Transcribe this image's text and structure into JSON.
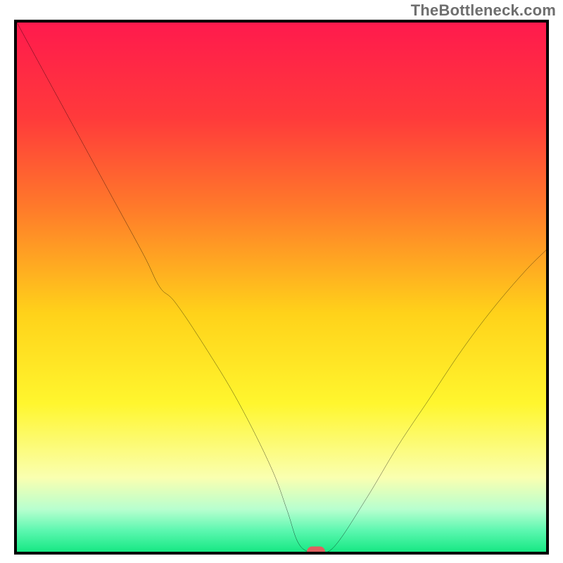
{
  "watermark": "TheBottleneck.com",
  "chart_data": {
    "type": "line",
    "title": "",
    "xlabel": "",
    "ylabel": "",
    "xlim": [
      0,
      100
    ],
    "ylim": [
      0,
      100
    ],
    "grid": false,
    "legend": false,
    "gradient_stops": [
      {
        "pos": 0.0,
        "color": "#ff1a4d"
      },
      {
        "pos": 0.18,
        "color": "#ff3a3b"
      },
      {
        "pos": 0.35,
        "color": "#ff7a2a"
      },
      {
        "pos": 0.55,
        "color": "#ffd21a"
      },
      {
        "pos": 0.72,
        "color": "#fff62e"
      },
      {
        "pos": 0.86,
        "color": "#faffb0"
      },
      {
        "pos": 0.92,
        "color": "#b7ffcf"
      },
      {
        "pos": 0.96,
        "color": "#5cf7b0"
      },
      {
        "pos": 1.0,
        "color": "#17e884"
      }
    ],
    "series": [
      {
        "name": "bottleneck-curve",
        "x": [
          0,
          6,
          12,
          18,
          24,
          27,
          30,
          36,
          42,
          48,
          51,
          53,
          55,
          57,
          60,
          66,
          72,
          78,
          84,
          90,
          96,
          100
        ],
        "y": [
          100,
          89,
          78,
          67,
          56,
          50,
          47,
          38,
          28,
          16,
          8,
          2,
          0,
          0,
          1,
          10,
          20,
          29,
          38,
          46,
          53,
          57
        ]
      }
    ],
    "marker": {
      "x": 56.5,
      "y": 0,
      "color": "#e06060"
    }
  }
}
